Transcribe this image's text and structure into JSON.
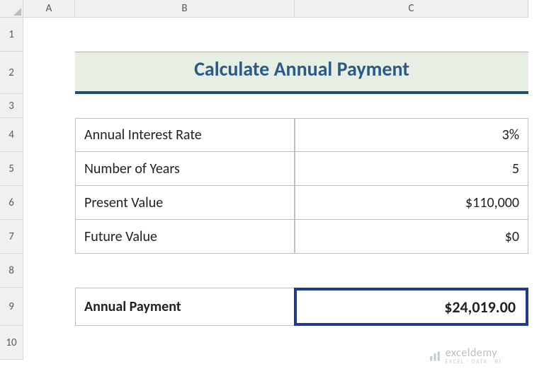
{
  "columns": [
    "A",
    "B",
    "C"
  ],
  "rows": [
    "1",
    "2",
    "3",
    "4",
    "5",
    "6",
    "7",
    "8",
    "9",
    "10"
  ],
  "title": "Calculate Annual Payment",
  "inputs": {
    "rate_label": "Annual Interest Rate",
    "rate_value": "3%",
    "years_label": "Number of Years",
    "years_value": "5",
    "pv_label": "Present Value",
    "pv_value": "$110,000",
    "fv_label": "Future Value",
    "fv_value": "$0"
  },
  "result": {
    "label": "Annual Payment",
    "value": "$24,019.00"
  },
  "watermark": {
    "name": "exceldemy",
    "tagline": "EXCEL · DATA · BI"
  },
  "chart_data": {
    "type": "table",
    "title": "Calculate Annual Payment",
    "rows": [
      {
        "label": "Annual Interest Rate",
        "value": "3%"
      },
      {
        "label": "Number of Years",
        "value": "5"
      },
      {
        "label": "Present Value",
        "value": "$110,000"
      },
      {
        "label": "Future Value",
        "value": "$0"
      },
      {
        "label": "Annual Payment",
        "value": "$24,019.00"
      }
    ]
  }
}
